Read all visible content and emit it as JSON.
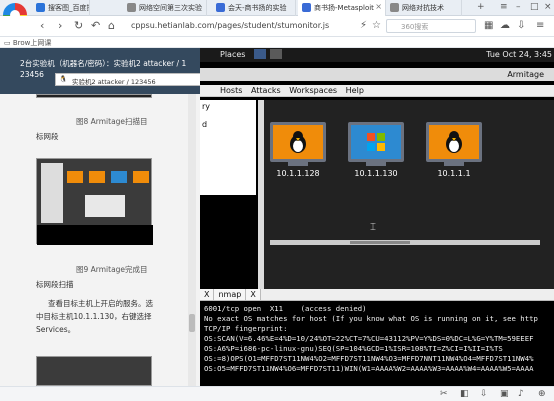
{
  "browser": {
    "tabs": [
      {
        "label": "搜客图_百度搜索"
      },
      {
        "label": "网络空间第三次实验"
      },
      {
        "label": "会天-商书扬的实验"
      },
      {
        "label": "商书扬-Metasploit"
      },
      {
        "label": "网络对抗技术"
      }
    ],
    "url": "cppsu.hetianlab.com/pages/student/stumonitor.js",
    "search_placeholder": "360搜索",
    "bookmark": "Brow上网课"
  },
  "lab": {
    "header_line1": "2台实验机（机器名/密码）：实验机2  attacker / 1",
    "header_line2": "23456",
    "vm_selector": "实验机2   attacker / 123456"
  },
  "doc": {
    "caption_fig8": "图8 Armitage扫描目",
    "para_fig8": "标网段",
    "caption_fig9": "图9 Armitage完成目",
    "para_fig9": "标网段扫描",
    "body_text": "查看目标主机上开启的服务。选中目标主机10.1.1.130，右键选择Services。"
  },
  "armitage": {
    "places": "Places",
    "datetime": "Tue Oct 24, 3:45",
    "title": "Armitage",
    "menu": [
      "Armitage",
      "View",
      "Hosts",
      "Attacks",
      "Workspaces",
      "Help"
    ],
    "tree_items": [
      "ry",
      "d"
    ],
    "hosts": [
      {
        "ip": "10.1.1.128",
        "os": "linux"
      },
      {
        "ip": "10.1.1.130",
        "os": "windows"
      },
      {
        "ip": "10.1.1.1",
        "os": "linux"
      }
    ],
    "bottom_tabs": [
      "X",
      "nmap",
      "X"
    ],
    "console_lines": [
      "6001/tcp open  X11    (access denied)",
      "No exact OS matches for host (If you know what OS is running on it, see http",
      "TCP/IP fingerprint:",
      "OS:SCAN(V=6.46%E=4%D=10/24%OT=22%CT=7%CU=43112%PV=Y%DS=0%DC=L%G=Y%TM=59EEEF",
      "OS:A6%P=i686-pc-linux-gnu)SEQ(SP=104%GCD=1%ISR=108%TI=Z%CI=I%II=I%TS",
      "OS:=8)OPS(O1=MFFD7ST11NW4%O2=MFFD7ST11NW4%O3=MFFD7NNT11NW4%O4=MFFD7ST11NW4%",
      "OS:O5=MFFD7ST11NW4%O6=MFFD7ST11)WIN(W1=AAAA%W2=AAAA%W3=AAAA%W4=AAAA%W5=AAAA"
    ]
  }
}
